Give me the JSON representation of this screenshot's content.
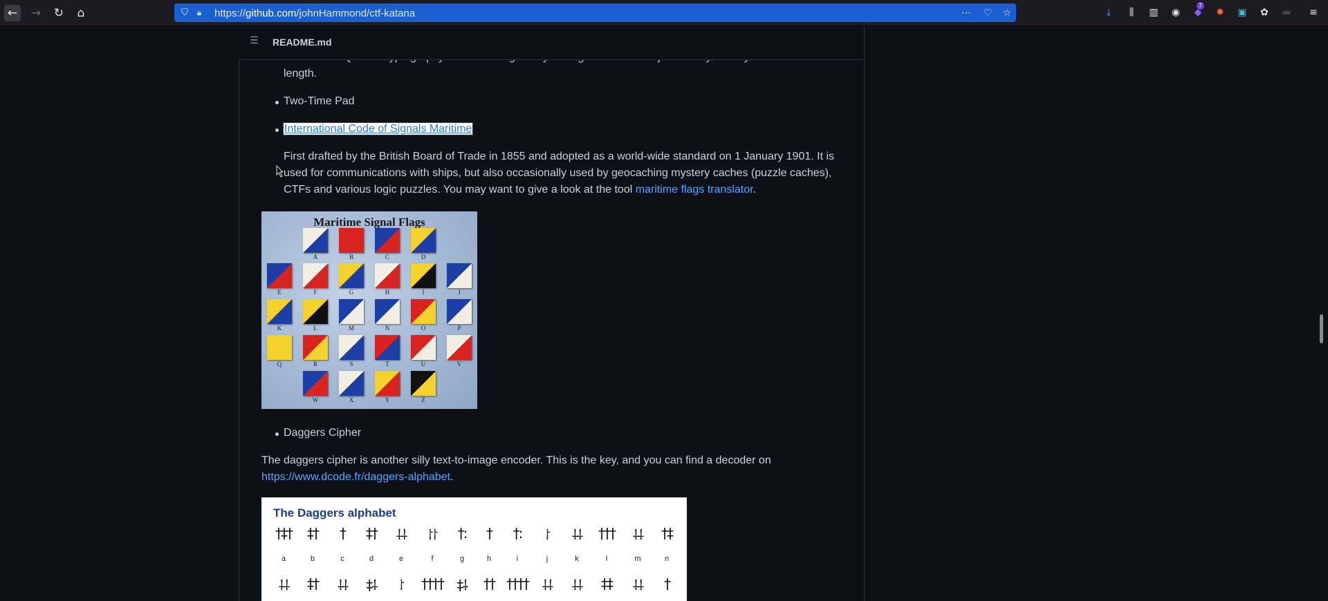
{
  "browser": {
    "url_prefix": "https://",
    "url_host": "github.com",
    "url_path": "/johnHammond/ctf-katana",
    "more_icon": "⋯",
    "pocket_icon": "♡",
    "bookmark_icon": "☆",
    "extension_badge": "7"
  },
  "readme": {
    "title": "README.md"
  },
  "content": {
    "para_top_partial": "The \"blind SQLi\" of cryptography... leak the flag out by testing for characters just one byte away from the block",
    "para_top_end": "length.",
    "item_two_time_pad": "Two-Time Pad",
    "item_signals_link": "International Code of Signals Maritime",
    "signals_para_1": "First drafted by the British Board of Trade in 1855 and adopted as a world-wide standard on 1 January 1901. It is",
    "signals_para_2": "used for communications with ships, but also occasionally used by geocaching mystery caches (puzzle caches),",
    "signals_para_3_start": "CTFs and various logic puzzles. You may want to give a look at the tool ",
    "signals_link": "maritime flags translator",
    "signals_para_3_end": ".",
    "flags_image_title": "Maritime Signal Flags",
    "item_daggers": "Daggers Cipher",
    "daggers_para_1": "The daggers cipher is another silly text-to-image encoder. This is the key, and you can find a decoder on",
    "daggers_link": "https://www.dcode.fr/daggers-alphabet",
    "daggers_para_end": ".",
    "daggers_image_title": "The Daggers alphabet"
  },
  "flags": {
    "A": [
      "#f2eee4",
      "#1d3fa5"
    ],
    "B": [
      "#d9231f",
      "#d9231f"
    ],
    "C": [
      "#1d3fa5",
      "#d9231f"
    ],
    "D": [
      "#f4d22d",
      "#1d3fa5"
    ],
    "E": [
      "#1d3fa5",
      "#d9231f"
    ],
    "F": [
      "#f2eee4",
      "#d9231f"
    ],
    "G": [
      "#f4d22d",
      "#1d3fa5"
    ],
    "H": [
      "#f2eee4",
      "#d9231f"
    ],
    "I": [
      "#f4d22d",
      "#111111"
    ],
    "J": [
      "#1d3fa5",
      "#f2eee4"
    ],
    "K": [
      "#f4d22d",
      "#1d3fa5"
    ],
    "L": [
      "#f4d22d",
      "#111111"
    ],
    "M": [
      "#1d3fa5",
      "#f2eee4"
    ],
    "N": [
      "#1d3fa5",
      "#f2eee4"
    ],
    "O": [
      "#d9231f",
      "#f4d22d"
    ],
    "P": [
      "#1d3fa5",
      "#f2eee4"
    ],
    "Q": [
      "#f4d22d",
      "#f4d22d"
    ],
    "R": [
      "#d9231f",
      "#f4d22d"
    ],
    "S": [
      "#f2eee4",
      "#1d3fa5"
    ],
    "T": [
      "#d9231f",
      "#1d3fa5"
    ],
    "U": [
      "#d9231f",
      "#f2eee4"
    ],
    "V": [
      "#f2eee4",
      "#d9231f"
    ],
    "W": [
      "#1d3fa5",
      "#d9231f"
    ],
    "X": [
      "#f2eee4",
      "#1d3fa5"
    ],
    "Y": [
      "#f4d22d",
      "#d9231f"
    ],
    "Z": [
      "#111111",
      "#f4d22d"
    ]
  },
  "daggers_row1": [
    "a",
    "b",
    "c",
    "d",
    "e",
    "f",
    "g",
    "h",
    "i",
    "j",
    "k",
    "l",
    "m",
    "n"
  ],
  "daggers_row1_glyphs": [
    "†‡†",
    "‡†",
    "†",
    "‡†",
    "⸸⸸",
    "⸷⸷",
    "†:",
    "†",
    "†:",
    "⸷",
    "⸸⸸",
    "†††",
    "⸸⸸",
    "†‡"
  ],
  "daggers_row2_glyphs": [
    "⸸⸸",
    "‡†",
    "⸸⸸",
    "‡⸸",
    "⸷",
    "††††",
    "‡⸸",
    "††",
    "††††",
    "⸸⸸",
    "⸸⸸",
    "‡‡",
    "⸸⸸",
    "†"
  ]
}
